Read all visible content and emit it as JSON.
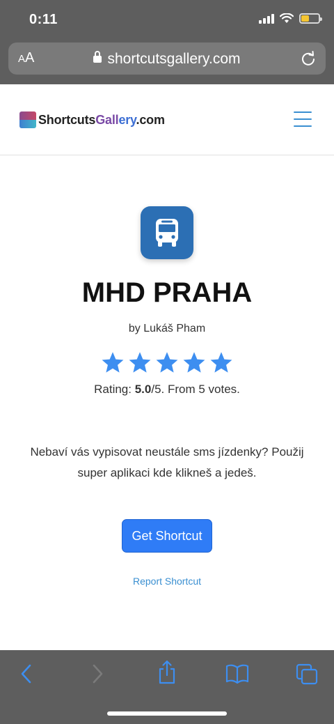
{
  "status_bar": {
    "time": "0:11"
  },
  "browser": {
    "text_size_label_small": "A",
    "text_size_label_large": "A",
    "url": "shortcutsgallery.com"
  },
  "site": {
    "logo_part1": "Shortcuts",
    "logo_part2": "Gall",
    "logo_part3": "ery",
    "logo_part4": ".com"
  },
  "shortcut": {
    "icon": "bus-icon",
    "title": "MHD PRAHA",
    "author": "by Lukáš Pham",
    "rating_prefix": "Rating: ",
    "rating_value": "5.0",
    "rating_suffix": "/5. From 5 votes.",
    "stars": 5,
    "description": "Nebaví vás vypisovat neustále sms jízdenky? Použij super aplikaci kde klikneš a jedeš.",
    "get_label": "Get Shortcut",
    "report_label": "Report Shortcut"
  },
  "colors": {
    "accent": "#2f7cf6",
    "icon_bg": "#2c6fb4",
    "star": "#3d8ef0",
    "link": "#3a8fd1"
  }
}
